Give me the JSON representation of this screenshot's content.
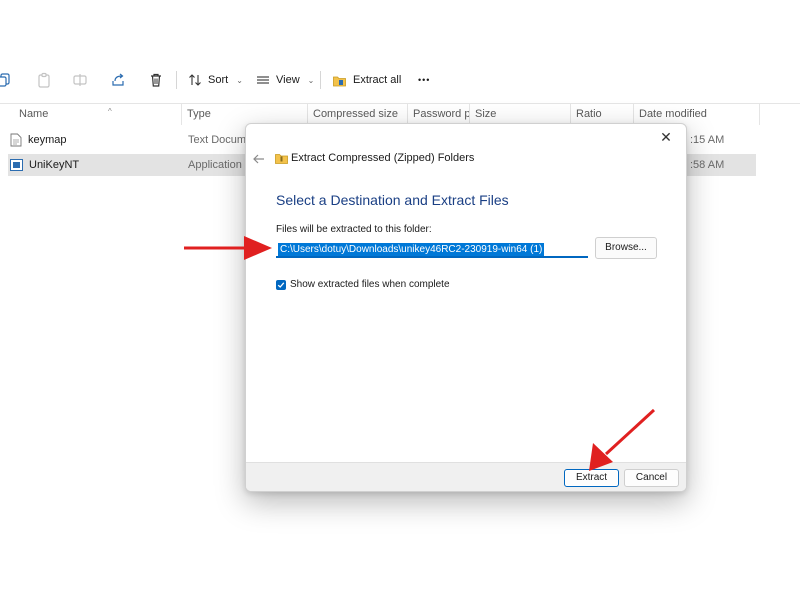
{
  "toolbar": {
    "sort_label": "Sort",
    "view_label": "View",
    "extract_all_label": "Extract all",
    "more_label": "•••",
    "icons": [
      "copy-icon",
      "paste-icon",
      "rename-icon",
      "share-icon",
      "delete-icon",
      "sort-icon",
      "view-icon",
      "extract-all-icon",
      "more-icon"
    ]
  },
  "columns": [
    "Name",
    "Type",
    "Compressed size",
    "Password p...",
    "Size",
    "Ratio",
    "Date modified"
  ],
  "files": [
    {
      "name": "keymap",
      "type": "Text Documen",
      "date": ":15 AM",
      "icon": "text-file-icon",
      "selected": false
    },
    {
      "name": "UniKeyNT",
      "type": "Application",
      "date": ":58 AM",
      "icon": "application-icon",
      "selected": true
    }
  ],
  "dialog": {
    "title": "Extract Compressed (Zipped) Folders",
    "heading": "Select a Destination and Extract Files",
    "path_label": "Files will be extracted to this folder:",
    "path_value": "C:\\Users\\dotuy\\Downloads\\unikey46RC2-230919-win64 (1)",
    "browse_label": "Browse...",
    "show_files_label": "Show extracted files when complete",
    "show_files_checked": true,
    "extract_label": "Extract",
    "cancel_label": "Cancel",
    "close_glyph": "✕",
    "accent_color": "#0067c0",
    "heading_color": "#1a3f84"
  },
  "annotations": {
    "arrow_color": "#e02020",
    "arrows": [
      "arrow-to-path-field",
      "arrow-to-extract-button"
    ]
  }
}
